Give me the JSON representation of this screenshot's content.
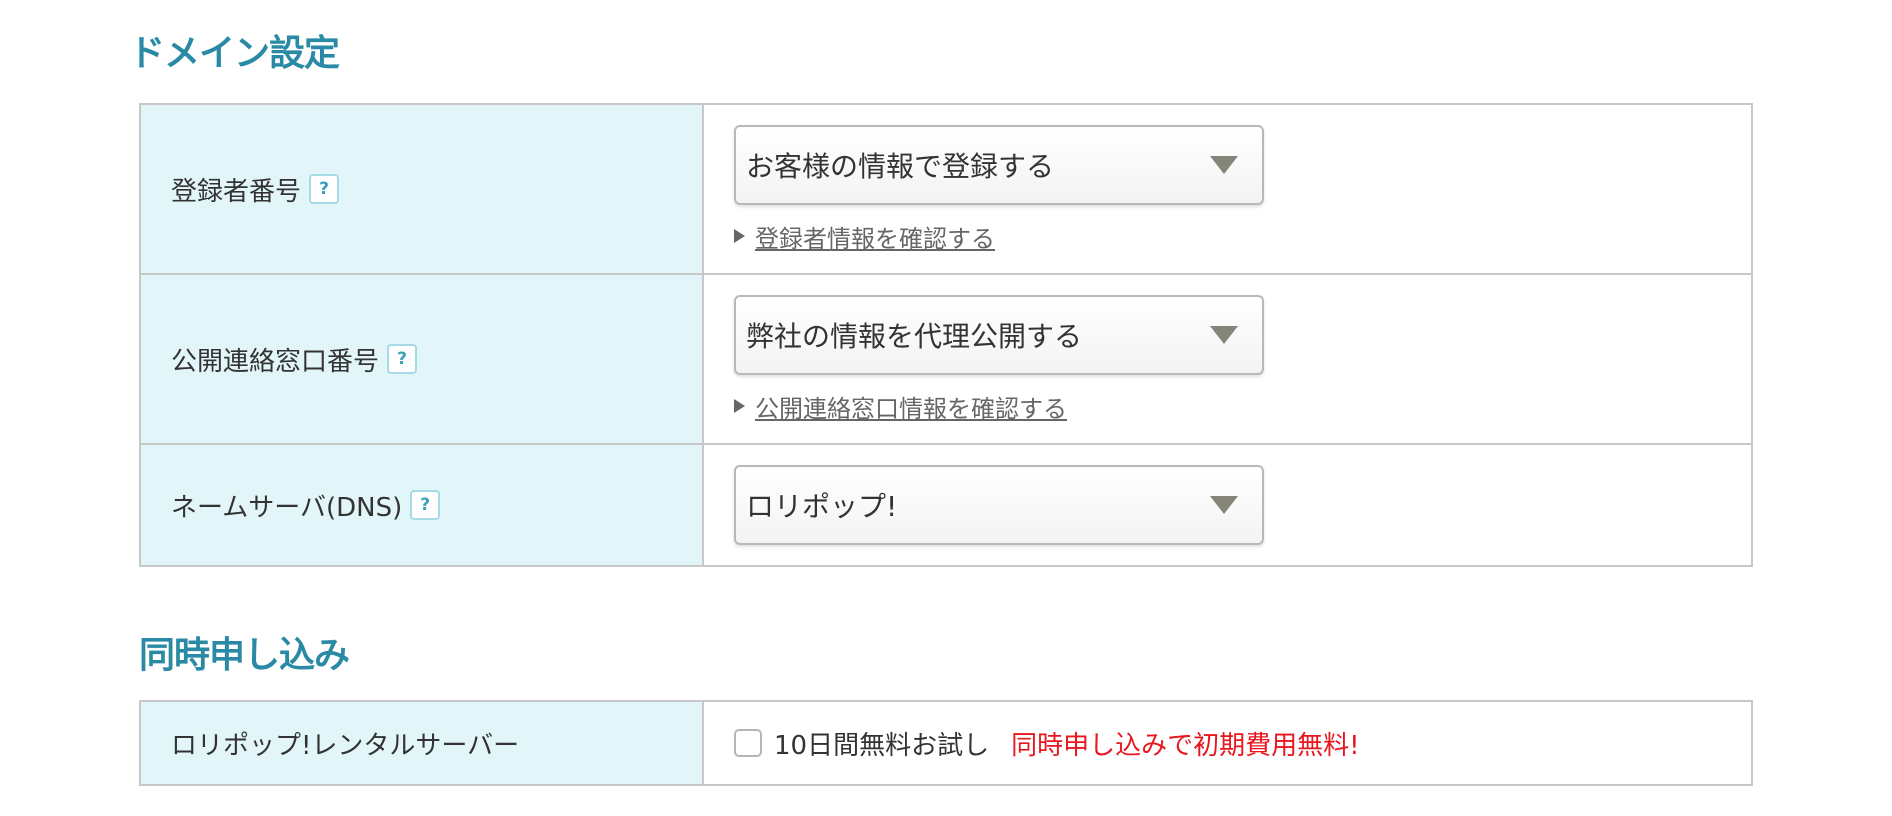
{
  "domain_section": {
    "title": "ドメイン設定",
    "rows": [
      {
        "label": "登録者番号",
        "help": "?",
        "select_value": "お客様の情報で登録する",
        "link_text": "登録者情報を確認する"
      },
      {
        "label": "公開連絡窓口番号",
        "help": "?",
        "select_value": "弊社の情報を代理公開する",
        "link_text": "公開連絡窓口情報を確認する"
      },
      {
        "label": "ネームサーバ(DNS)",
        "help": "?",
        "select_value": "ロリポップ!"
      }
    ]
  },
  "simultaneous_section": {
    "title": "同時申し込み",
    "row": {
      "label": "ロリポップ!レンタルサーバー",
      "checkbox_checked": false,
      "checkbox_label": "10日間無料お試し",
      "promo": "同時申し込みで初期費用無料!"
    }
  },
  "colors": {
    "section_title": "#2a8aa6",
    "header_cell_bg": "#e2f6fa",
    "border": "#c8c8c8",
    "promo_red": "#e8171e",
    "select_arrow": "#858478"
  },
  "icons": {
    "help": "question-mark-help-icon",
    "select": "triangle-down-icon",
    "link": "triangle-right-icon"
  }
}
